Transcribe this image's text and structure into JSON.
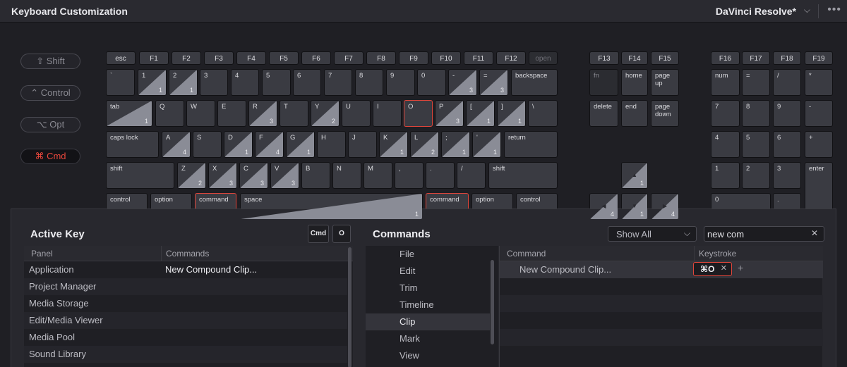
{
  "window": {
    "title": "Keyboard Customization",
    "preset": "DaVinci Resolve*",
    "chevron": "⌵",
    "more": "•••"
  },
  "modifiers": [
    {
      "label": "⇧ Shift",
      "active": false
    },
    {
      "label": "⌃ Control",
      "active": false
    },
    {
      "label": "⌥ Opt",
      "active": false
    },
    {
      "label": "⌘ Cmd",
      "active": true
    }
  ],
  "keys": {
    "esc": "esc",
    "f1": "F1",
    "f2": "F2",
    "f3": "F3",
    "f4": "F4",
    "f5": "F5",
    "f6": "F6",
    "f7": "F7",
    "f8": "F8",
    "f9": "F9",
    "f10": "F10",
    "f11": "F11",
    "f12": "F12",
    "open": "open",
    "f13": "F13",
    "f14": "F14",
    "f15": "F15",
    "f16": "F16",
    "f17": "F17",
    "f18": "F18",
    "f19": "F19",
    "grave": "`",
    "n1": "1",
    "n2": "2",
    "n3": "3",
    "n4": "4",
    "n5": "5",
    "n6": "6",
    "n7": "7",
    "n8": "8",
    "n9": "9",
    "n0": "0",
    "minus": "-",
    "equals": "=",
    "backspace": "backspace",
    "tab": "tab",
    "q": "Q",
    "w": "W",
    "e": "E",
    "r": "R",
    "t": "T",
    "y": "Y",
    "u": "U",
    "i": "I",
    "o": "O",
    "p": "P",
    "lbracket": "[",
    "rbracket": "]",
    "backslash": "\\",
    "capslock": "caps lock",
    "a": "A",
    "s": "S",
    "d": "D",
    "f": "F",
    "g": "G",
    "h": "H",
    "j": "J",
    "k": "K",
    "l": "L",
    "semicolon": ";",
    "quote": "'",
    "return": "return",
    "lshift": "shift",
    "z": "Z",
    "x": "X",
    "c": "C",
    "v": "V",
    "b": "B",
    "n": "N",
    "m": "M",
    "comma": ",",
    "period": ".",
    "slash": "/",
    "rshift": "shift",
    "lcontrol": "control",
    "loption": "option",
    "lcommand": "command",
    "space": "space",
    "rcommand": "command",
    "roption": "option",
    "rcontrol": "control",
    "fnkey": "fn",
    "home": "home",
    "pageup": "page\nup",
    "delete": "delete",
    "end": "end",
    "pagedown": "page\ndown",
    "up": "▲",
    "left": "◀",
    "down": "▼",
    "right": "▶",
    "num": "num",
    "kpeq": "=",
    "kpslash": "/",
    "kpstar": "*",
    "kp7": "7",
    "kp8": "8",
    "kp9": "9",
    "kpminus": "-",
    "kp4": "4",
    "kp5": "5",
    "kp6": "6",
    "kpplus": "+",
    "kp1": "1",
    "kp2": "2",
    "kp3": "3",
    "kpenter": "enter",
    "kp0": "0",
    "kpdot": "."
  },
  "key_counts": {
    "n1": "1",
    "n2": "1",
    "minus": "3",
    "equals": "3",
    "tab": "1",
    "r": "3",
    "y": "2",
    "p": "3",
    "lbracket": "1",
    "rbracket": "1",
    "a": "4",
    "d": "1",
    "f": "4",
    "g": "1",
    "k": "1",
    "l": "2",
    "semicolon": "1",
    "quote": "1",
    "z": "2",
    "x": "3",
    "c": "3",
    "v": "3",
    "space": "1",
    "up": "1",
    "left": "4",
    "down": "1",
    "right": "4"
  },
  "active_key": {
    "heading": "Active Key",
    "cmd_chip": "Cmd",
    "key_chip": "O",
    "columns": [
      "Panel",
      "Commands"
    ],
    "rows": [
      {
        "panel": "Application",
        "command": "New Compound Clip..."
      },
      {
        "panel": "Project Manager",
        "command": ""
      },
      {
        "panel": "Media Storage",
        "command": ""
      },
      {
        "panel": "Edit/Media Viewer",
        "command": ""
      },
      {
        "panel": "Media Pool",
        "command": ""
      },
      {
        "panel": "Sound Library",
        "command": ""
      }
    ]
  },
  "commands": {
    "heading": "Commands",
    "filter": "Show All",
    "search_value": "new com",
    "categories": [
      "File",
      "Edit",
      "Trim",
      "Timeline",
      "Clip",
      "Mark",
      "View"
    ],
    "selected_category": "Clip",
    "columns": [
      "Command",
      "Keystroke"
    ],
    "rows": [
      {
        "command": "New Compound Clip...",
        "keystroke": "⌘O"
      }
    ],
    "clear": "✕",
    "add": "+"
  },
  "colors": {
    "accent": "#e0453a",
    "key": "#3a3b42",
    "assigned": "#8a8c96",
    "background": "#1f1f24"
  }
}
